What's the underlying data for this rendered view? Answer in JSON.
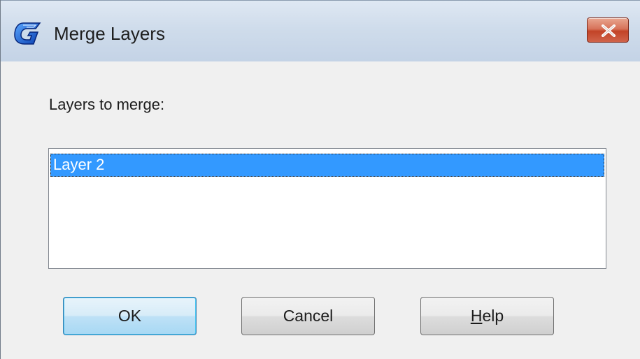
{
  "window": {
    "title": "Merge Layers",
    "app_icon": "app-logo-icon",
    "close_icon": "close-icon",
    "colors": {
      "close_button": "#c24327",
      "selection": "#3399ff",
      "default_button_border": "#3c7fb1"
    }
  },
  "dialog": {
    "prompt_label": "Layers to merge:",
    "layers": [
      {
        "label": "Layer 2",
        "selected": true
      }
    ],
    "buttons": {
      "ok_label": "OK",
      "cancel_label": "Cancel",
      "help_label_mnemonic": "H",
      "help_label_rest": "elp"
    }
  }
}
